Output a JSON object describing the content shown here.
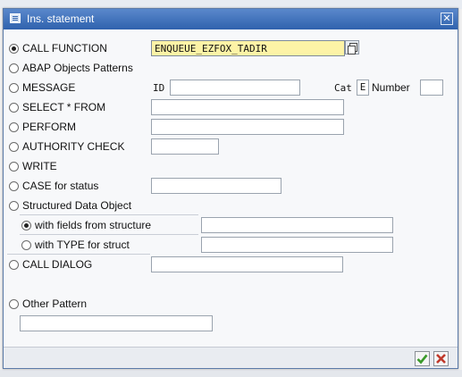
{
  "dialog": {
    "title": "Ins. statement",
    "icon": "statement-dialog-icon",
    "close_glyph": "✕"
  },
  "options": {
    "call_function": {
      "label": "CALL FUNCTION",
      "value": "ENQUEUE_EZFOX_TADIR",
      "selected": true
    },
    "abap_objects_patterns": {
      "label": "ABAP Objects Patterns"
    },
    "message": {
      "label": "MESSAGE",
      "id_label": "ID",
      "cat_label": "Cat",
      "cat_value": "E",
      "number_label": "Number",
      "id_value": "",
      "number_value": ""
    },
    "select_from": {
      "label": "SELECT * FROM",
      "value": ""
    },
    "perform": {
      "label": "PERFORM",
      "value": ""
    },
    "authority_check": {
      "label": "AUTHORITY CHECK",
      "value": ""
    },
    "write": {
      "label": "WRITE"
    },
    "case_for_status": {
      "label": "CASE for status",
      "value": ""
    },
    "structured_data_object": {
      "label": "Structured Data Object",
      "with_fields": {
        "label": "with fields from structure",
        "value": "",
        "selected": true
      },
      "with_type": {
        "label": "with TYPE for struct",
        "value": ""
      }
    },
    "call_dialog": {
      "label": "CALL DIALOG",
      "value": ""
    },
    "other_pattern": {
      "label": "Other Pattern",
      "value": ""
    }
  },
  "footer": {
    "ok_icon": "checkmark-icon",
    "cancel_icon": "cancel-x-icon"
  },
  "colors": {
    "title_bar": "#2f62ad",
    "active_field": "#fdf3a6",
    "ok_green": "#3a9a2a",
    "cancel_red": "#c0392b"
  }
}
